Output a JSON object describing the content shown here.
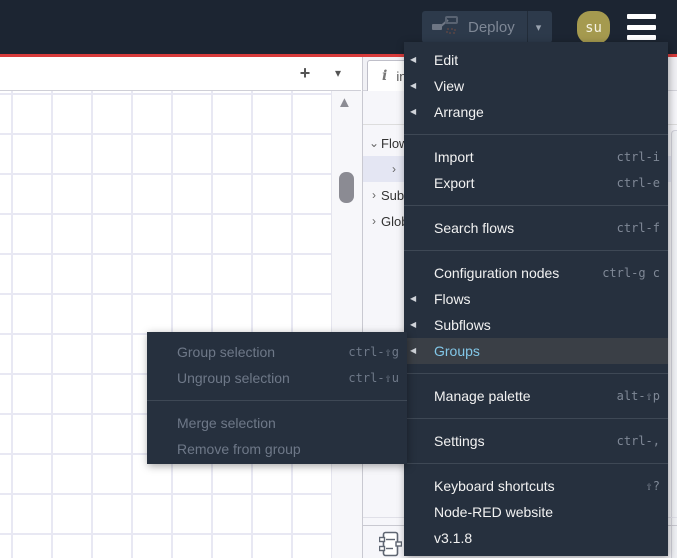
{
  "header": {
    "deploy_label": "Deploy",
    "user_initials": "su"
  },
  "icons": {
    "left_arrow": "◀",
    "caret_down": "▾",
    "plus": "+",
    "up_triangle": "▲",
    "caret_expanded": "⌄",
    "caret_collapsed": "›",
    "info_glyph": "i",
    "shift_glyph": "⇧"
  },
  "workspace": {
    "add_flow_label": "+",
    "flow_list_label": "▾"
  },
  "sidebar": {
    "tab": {
      "icon": "i",
      "label": "info"
    },
    "tree": [
      {
        "caret": "⌄",
        "label": "Flows",
        "selected": false,
        "indent": 0
      },
      {
        "caret": "›",
        "label": "",
        "selected": true,
        "indent": 1
      },
      {
        "caret": "›",
        "label": "Subflows",
        "selected": false,
        "indent": 0
      },
      {
        "caret": "›",
        "label": "Global Configuration Nodes",
        "selected": false,
        "indent": 0
      }
    ]
  },
  "menu": {
    "items": [
      {
        "label": "Edit",
        "shortcut": "",
        "arrow": true
      },
      {
        "label": "View",
        "shortcut": "",
        "arrow": true
      },
      {
        "label": "Arrange",
        "shortcut": "",
        "arrow": true
      },
      {
        "label": "Import",
        "shortcut": "ctrl-i",
        "arrow": false
      },
      {
        "label": "Export",
        "shortcut": "ctrl-e",
        "arrow": false
      },
      {
        "label": "Search flows",
        "shortcut": "ctrl-f",
        "arrow": false
      },
      {
        "label": "Configuration nodes",
        "shortcut": "ctrl-g c",
        "arrow": false
      },
      {
        "label": "Flows",
        "shortcut": "",
        "arrow": true
      },
      {
        "label": "Subflows",
        "shortcut": "",
        "arrow": true
      },
      {
        "label": "Groups",
        "shortcut": "",
        "arrow": true,
        "highlighted": true
      },
      {
        "label": "Manage palette",
        "shortcut": "alt-⇧p",
        "arrow": false
      },
      {
        "label": "Settings",
        "shortcut": "ctrl-,",
        "arrow": false
      },
      {
        "label": "Keyboard shortcuts",
        "shortcut": "⇧?",
        "arrow": false
      },
      {
        "label": "Node-RED website",
        "shortcut": "",
        "arrow": false
      },
      {
        "label": "v3.1.8",
        "shortcut": "",
        "arrow": false
      }
    ]
  },
  "submenu": {
    "items": [
      {
        "label": "Group selection",
        "shortcut": "ctrl-⇧g"
      },
      {
        "label": "Ungroup selection",
        "shortcut": "ctrl-⇧u"
      },
      {
        "label": "Merge selection",
        "shortcut": ""
      },
      {
        "label": "Remove from group",
        "shortcut": ""
      }
    ]
  },
  "colors": {
    "header_bg": "#1c2532",
    "menu_bg": "#26303e",
    "accent_red": "#d83b3b",
    "highlight_row_bg": "#3a3f46",
    "highlight_text": "#82c7e8",
    "avatar_bg": "#a59a4f",
    "grid_line": "#e8e8f3",
    "selected_tree_row": "#e4e6f3"
  }
}
